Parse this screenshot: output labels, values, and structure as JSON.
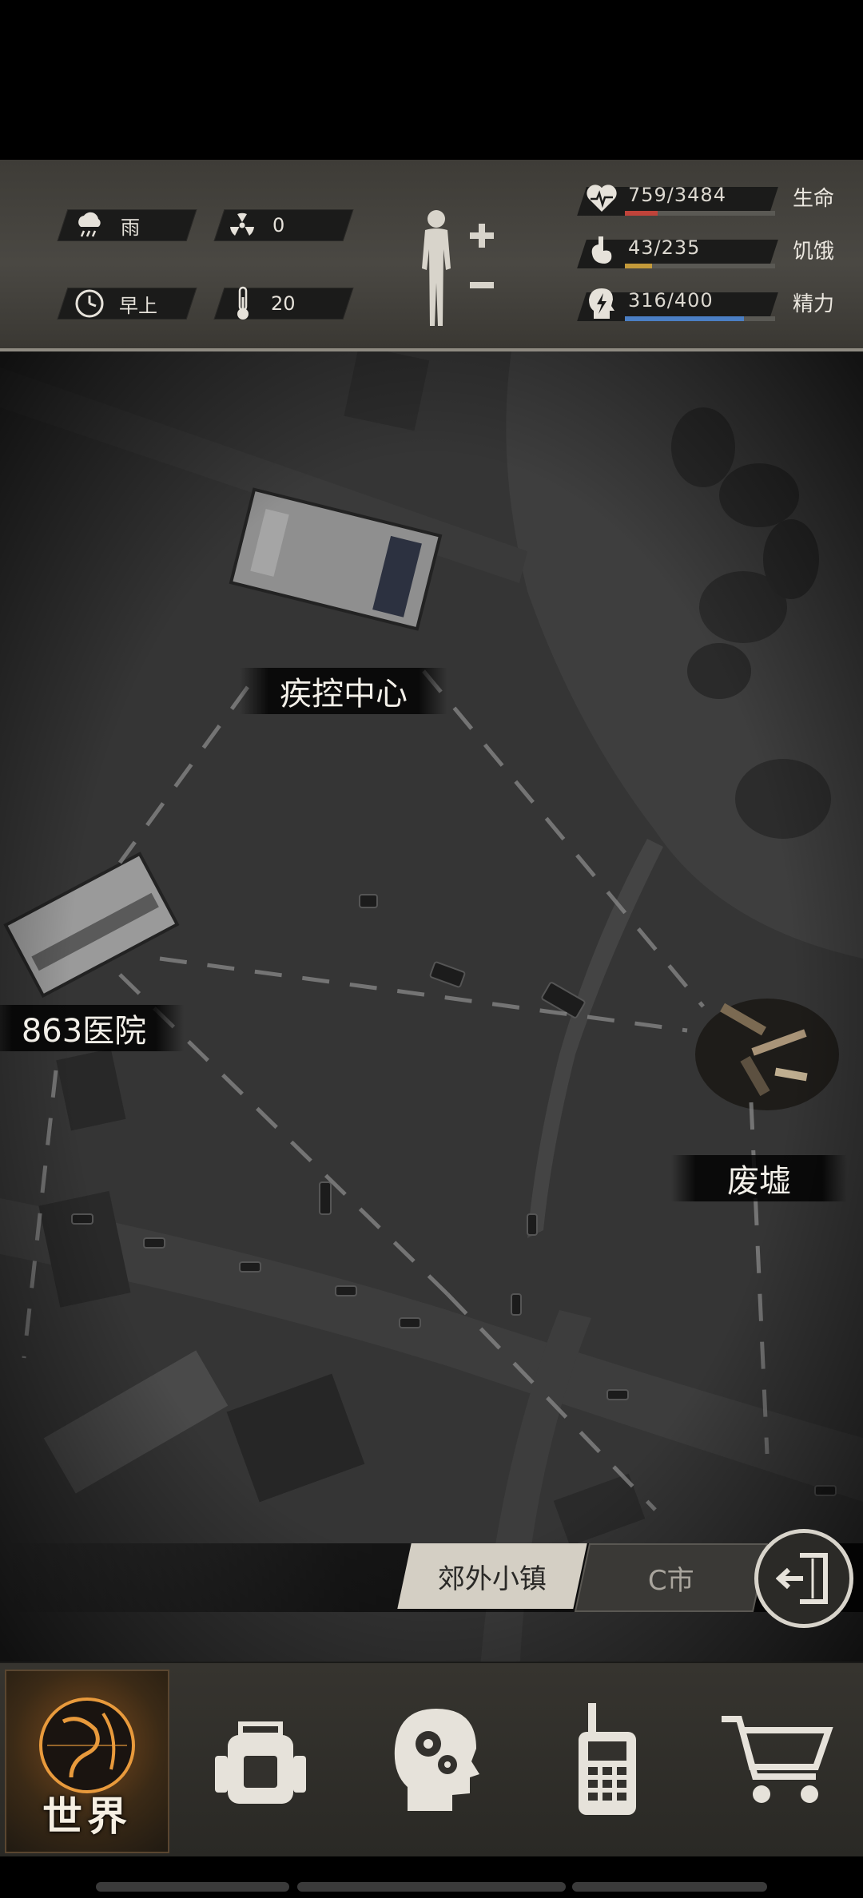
{
  "weather": {
    "icon": "rain-cloud-icon",
    "label": "雨"
  },
  "radiation": {
    "icon": "radiation-icon",
    "value": "0"
  },
  "time_of_day": {
    "icon": "clock-icon",
    "label": "早上"
  },
  "temperature": {
    "icon": "thermometer-icon",
    "value": "20"
  },
  "body_status": {
    "plus_icon": "plus-icon",
    "minus_icon": "minus-icon"
  },
  "stats": {
    "health": {
      "icon": "heart-pulse-icon",
      "value": "759/3484",
      "label": "生命",
      "fraction": 0.218,
      "color": "#c0433a"
    },
    "hunger": {
      "icon": "stomach-icon",
      "value": "43/235",
      "label": "饥饿",
      "fraction": 0.183,
      "color": "#c49a3a"
    },
    "energy": {
      "icon": "head-lightning-icon",
      "value": "316/400",
      "label": "精力",
      "fraction": 0.79,
      "color": "#4b7fc4"
    }
  },
  "map": {
    "locations": [
      {
        "name": "疾控中心"
      },
      {
        "name": "863医院"
      },
      {
        "name": "废墟"
      }
    ]
  },
  "region_tabs": {
    "active": "郊外小镇",
    "other": "C市"
  },
  "exit_button": {
    "icon": "exit-door-icon"
  },
  "nav": {
    "world": {
      "label": "世界",
      "icon": "globe-icon"
    },
    "backpack": {
      "icon": "backpack-icon"
    },
    "skills": {
      "icon": "head-gears-icon"
    },
    "radio": {
      "icon": "walkie-talkie-icon"
    },
    "shop": {
      "icon": "shopping-cart-icon"
    }
  }
}
